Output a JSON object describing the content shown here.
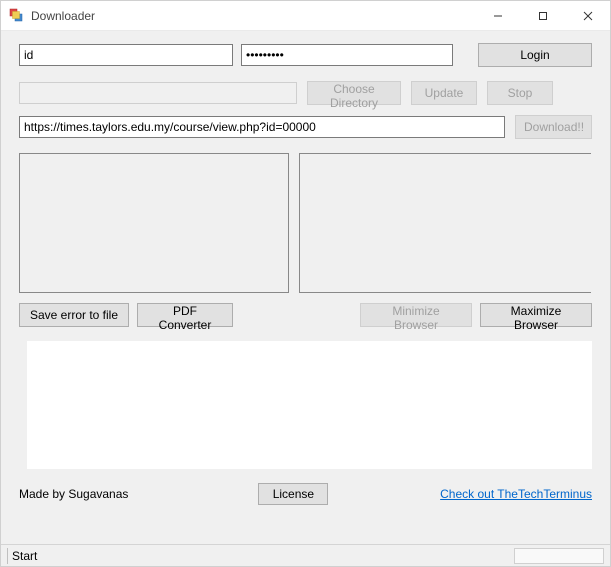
{
  "window": {
    "title": "Downloader"
  },
  "login": {
    "id_value": "id",
    "password_value": "•••••••••",
    "login_label": "Login"
  },
  "directory": {
    "choose_label": "Choose Directory",
    "update_label": "Update",
    "stop_label": "Stop"
  },
  "download": {
    "url_value": "https://times.taylors.edu.my/course/view.php?id=00000",
    "download_label": "Download!!"
  },
  "actions": {
    "save_error_label": "Save error to file",
    "pdf_converter_label": "PDF Converter",
    "minimize_label": "Minimize Browser",
    "maximize_label": "Maximize Browser"
  },
  "footer": {
    "credit": "Made by Sugavanas",
    "license_label": "License",
    "link_text": "Check out TheTechTerminus"
  },
  "status": {
    "text": "Start"
  }
}
